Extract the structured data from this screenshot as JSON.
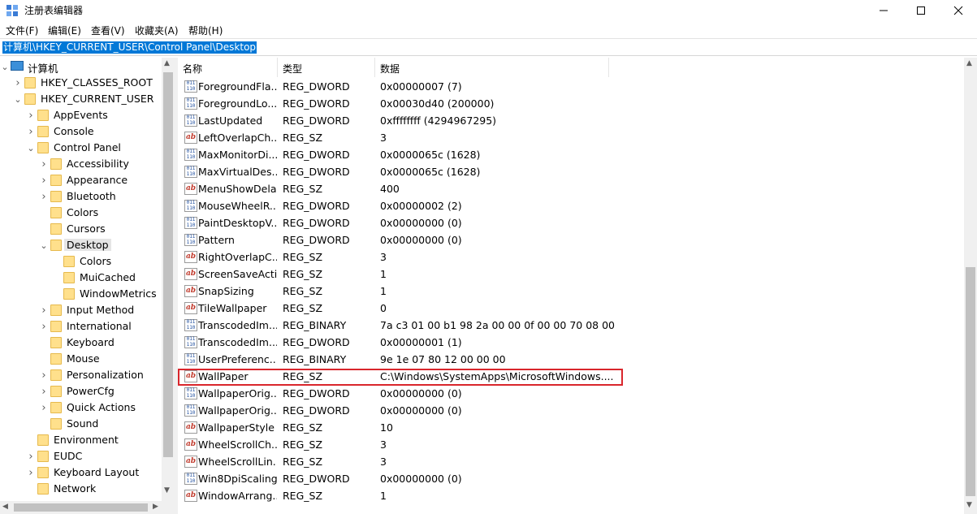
{
  "window": {
    "title": "注册表编辑器"
  },
  "menu": {
    "items": [
      "文件(F)",
      "编辑(E)",
      "查看(V)",
      "收藏夹(A)",
      "帮助(H)"
    ]
  },
  "address": {
    "path": "计算机\\HKEY_CURRENT_USER\\Control Panel\\Desktop"
  },
  "tree": {
    "items": [
      {
        "label": "计算机",
        "level": 0,
        "expanded": true,
        "icon": "computer-icon"
      },
      {
        "label": "HKEY_CLASSES_ROOT",
        "level": 1,
        "expanded": false
      },
      {
        "label": "HKEY_CURRENT_USER",
        "level": 1,
        "expanded": true
      },
      {
        "label": "AppEvents",
        "level": 2,
        "expanded": false
      },
      {
        "label": "Console",
        "level": 2,
        "expanded": false
      },
      {
        "label": "Control Panel",
        "level": 2,
        "expanded": true
      },
      {
        "label": "Accessibility",
        "level": 3,
        "expanded": false
      },
      {
        "label": "Appearance",
        "level": 3,
        "expanded": false
      },
      {
        "label": "Bluetooth",
        "level": 3,
        "expanded": false
      },
      {
        "label": "Colors",
        "level": 3,
        "leaf": true
      },
      {
        "label": "Cursors",
        "level": 3,
        "leaf": true
      },
      {
        "label": "Desktop",
        "level": 3,
        "expanded": true,
        "selected": true
      },
      {
        "label": "Colors",
        "level": 4,
        "leaf": true
      },
      {
        "label": "MuiCached",
        "level": 4,
        "leaf": true
      },
      {
        "label": "WindowMetrics",
        "level": 4,
        "leaf": true
      },
      {
        "label": "Input Method",
        "level": 3,
        "expanded": false
      },
      {
        "label": "International",
        "level": 3,
        "expanded": false
      },
      {
        "label": "Keyboard",
        "level": 3,
        "leaf": true
      },
      {
        "label": "Mouse",
        "level": 3,
        "leaf": true
      },
      {
        "label": "Personalization",
        "level": 3,
        "expanded": false
      },
      {
        "label": "PowerCfg",
        "level": 3,
        "expanded": false
      },
      {
        "label": "Quick Actions",
        "level": 3,
        "expanded": false
      },
      {
        "label": "Sound",
        "level": 3,
        "leaf": true
      },
      {
        "label": "Environment",
        "level": 2,
        "leaf": true
      },
      {
        "label": "EUDC",
        "level": 2,
        "expanded": false
      },
      {
        "label": "Keyboard Layout",
        "level": 2,
        "expanded": false
      },
      {
        "label": "Network",
        "level": 2,
        "leaf": true
      }
    ]
  },
  "list": {
    "headers": {
      "name": "名称",
      "type": "类型",
      "data": "数据"
    },
    "rows": [
      {
        "name": "ForegroundFla...",
        "type": "REG_DWORD",
        "data": "0x00000007 (7)",
        "kind": "dword"
      },
      {
        "name": "ForegroundLo...",
        "type": "REG_DWORD",
        "data": "0x00030d40 (200000)",
        "kind": "dword"
      },
      {
        "name": "LastUpdated",
        "type": "REG_DWORD",
        "data": "0xffffffff (4294967295)",
        "kind": "dword"
      },
      {
        "name": "LeftOverlapCh...",
        "type": "REG_SZ",
        "data": "3",
        "kind": "sz"
      },
      {
        "name": "MaxMonitorDi...",
        "type": "REG_DWORD",
        "data": "0x0000065c (1628)",
        "kind": "dword"
      },
      {
        "name": "MaxVirtualDes...",
        "type": "REG_DWORD",
        "data": "0x0000065c (1628)",
        "kind": "dword"
      },
      {
        "name": "MenuShowDelay",
        "type": "REG_SZ",
        "data": "400",
        "kind": "sz"
      },
      {
        "name": "MouseWheelR...",
        "type": "REG_DWORD",
        "data": "0x00000002 (2)",
        "kind": "dword"
      },
      {
        "name": "PaintDesktopV...",
        "type": "REG_DWORD",
        "data": "0x00000000 (0)",
        "kind": "dword"
      },
      {
        "name": "Pattern",
        "type": "REG_DWORD",
        "data": "0x00000000 (0)",
        "kind": "dword"
      },
      {
        "name": "RightOverlapC...",
        "type": "REG_SZ",
        "data": "3",
        "kind": "sz"
      },
      {
        "name": "ScreenSaveActi...",
        "type": "REG_SZ",
        "data": "1",
        "kind": "sz"
      },
      {
        "name": "SnapSizing",
        "type": "REG_SZ",
        "data": "1",
        "kind": "sz"
      },
      {
        "name": "TileWallpaper",
        "type": "REG_SZ",
        "data": "0",
        "kind": "sz"
      },
      {
        "name": "TranscodedIm...",
        "type": "REG_BINARY",
        "data": "7a c3 01 00 b1 98 2a 00 00 0f 00 00 70 08 00 ...",
        "kind": "bin"
      },
      {
        "name": "TranscodedIm...",
        "type": "REG_DWORD",
        "data": "0x00000001 (1)",
        "kind": "dword"
      },
      {
        "name": "UserPreferenc...",
        "type": "REG_BINARY",
        "data": "9e 1e 07 80 12 00 00 00",
        "kind": "bin"
      },
      {
        "name": "WallPaper",
        "type": "REG_SZ",
        "data": "C:\\Windows\\SystemApps\\MicrosoftWindows....",
        "kind": "sz",
        "highlighted": true
      },
      {
        "name": "WallpaperOrig...",
        "type": "REG_DWORD",
        "data": "0x00000000 (0)",
        "kind": "dword"
      },
      {
        "name": "WallpaperOrig...",
        "type": "REG_DWORD",
        "data": "0x00000000 (0)",
        "kind": "dword"
      },
      {
        "name": "WallpaperStyle",
        "type": "REG_SZ",
        "data": "10",
        "kind": "sz"
      },
      {
        "name": "WheelScrollCh...",
        "type": "REG_SZ",
        "data": "3",
        "kind": "sz"
      },
      {
        "name": "WheelScrollLin...",
        "type": "REG_SZ",
        "data": "3",
        "kind": "sz"
      },
      {
        "name": "Win8DpiScaling",
        "type": "REG_DWORD",
        "data": "0x00000000 (0)",
        "kind": "dword"
      },
      {
        "name": "WindowArrang...",
        "type": "REG_SZ",
        "data": "1",
        "kind": "sz"
      }
    ]
  },
  "colors": {
    "selection": "#0078d7",
    "highlight_box": "#d9262c"
  }
}
